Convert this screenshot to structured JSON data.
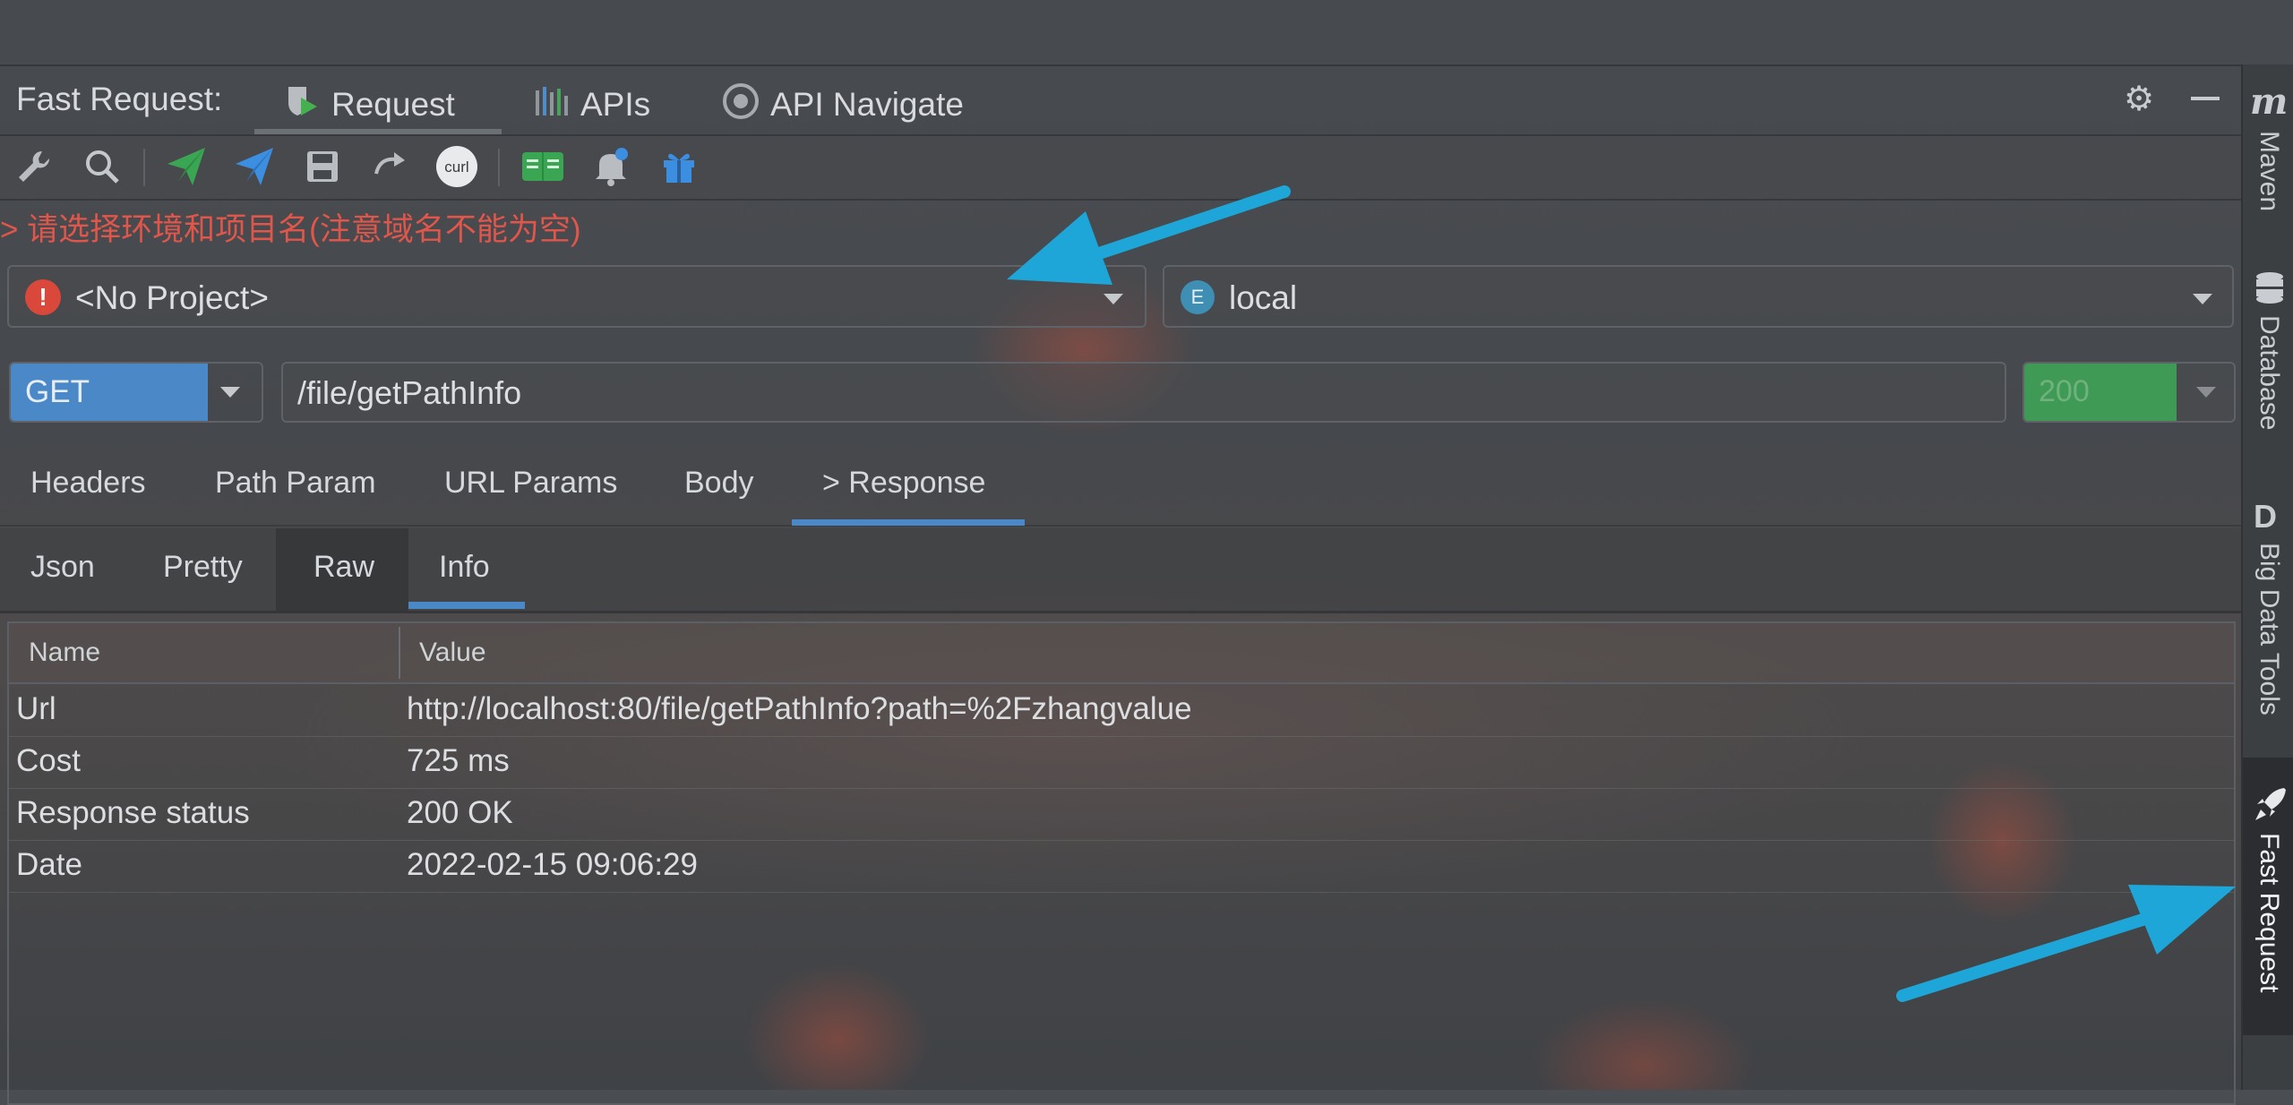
{
  "header": {
    "title": "Fast Request:",
    "tabs": [
      {
        "label": "Request"
      },
      {
        "label": "APIs"
      },
      {
        "label": "API Navigate"
      }
    ]
  },
  "toolbar": {
    "icons": [
      "wrench-icon",
      "search-icon",
      "send-green-icon",
      "send-blue-icon",
      "save-icon",
      "redo-icon",
      "curl-icon",
      "doc-icon",
      "bell-icon",
      "gift-icon"
    ],
    "curl_label": "curl"
  },
  "warning": "> 请选择环境和项目名(注意域名不能为空)",
  "project_select": {
    "value": "<No Project>"
  },
  "env_select": {
    "badge": "E",
    "value": "local"
  },
  "request": {
    "method": "GET",
    "url": "/file/getPathInfo",
    "status": "200"
  },
  "param_tabs": [
    "Headers",
    "Path Param",
    "URL Params",
    "Body",
    "> Response"
  ],
  "response_tabs": [
    "Json",
    "Pretty",
    "Raw",
    "Info"
  ],
  "info_table": {
    "headers": [
      "Name",
      "Value"
    ],
    "rows": [
      {
        "name": "Url",
        "value": "http://localhost:80/file/getPathInfo?path=%2Fzhangvalue"
      },
      {
        "name": "Cost",
        "value": "725 ms"
      },
      {
        "name": "Response status",
        "value": "200 OK"
      },
      {
        "name": "Date",
        "value": "2022-02-15 09:06:29"
      }
    ]
  },
  "sidebar": {
    "items": [
      {
        "icon_letter": "m",
        "label": "Maven"
      },
      {
        "label": "Database"
      },
      {
        "icon_letter": "D",
        "label": "Big Data Tools"
      },
      {
        "label": "Fast Request"
      }
    ]
  },
  "colors": {
    "accent_blue": "#4a88c7",
    "status_green": "#3f9a55",
    "warning_red": "#e0564b",
    "annotation_arrow": "#1ea6d8"
  }
}
